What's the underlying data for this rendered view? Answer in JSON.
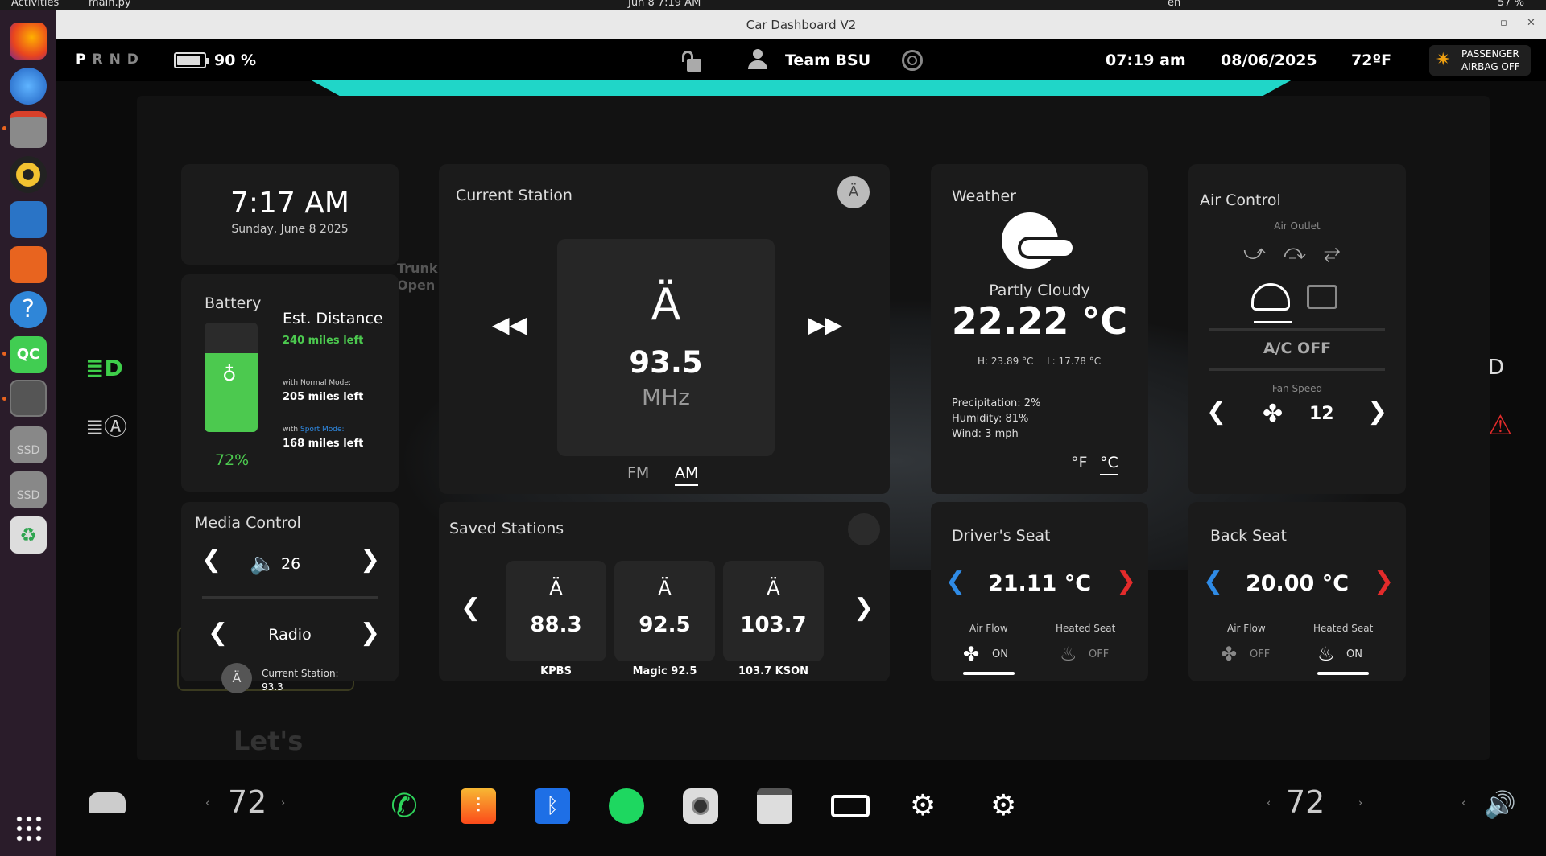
{
  "system": {
    "activities": "Activities",
    "app_menu": "main.py",
    "clock": "Jun 8 7:19 AM",
    "locale": "en",
    "battery_pct": "57 %"
  },
  "window": {
    "title": "Car Dashboard V2"
  },
  "status": {
    "gears": [
      "P",
      "R",
      "N",
      "D"
    ],
    "active_gear": "P",
    "battery": "90 %",
    "user": "Team BSU",
    "time": "07:19 am",
    "date": "08/06/2025",
    "temp": "72ºF",
    "airbag_line1": "PASSENGER",
    "airbag_line2": "AIRBAG OFF"
  },
  "clock_card": {
    "time": "7:17 AM",
    "date": "Sunday, June 8 2025"
  },
  "battery_card": {
    "title": "Battery",
    "percent": "72%",
    "level": 0.72,
    "est_title": "Est. Distance",
    "est_miles": "240 miles left",
    "normal_prefix": "with",
    "normal_label": "Normal Mode:",
    "normal_miles": "205 miles left",
    "sport_prefix": "with",
    "sport_label": "Sport Mode:",
    "sport_miles": "168 miles left"
  },
  "background_car": {
    "trunk": "Trunk",
    "open": "Open",
    "lets": "Let's"
  },
  "media": {
    "title": "Media Control",
    "volume": "26",
    "source": "Radio",
    "current_label": "Current Station:",
    "current_value": "93.3"
  },
  "station": {
    "title": "Current Station",
    "freq": "93.5",
    "unit": "MHz",
    "band_fm": "FM",
    "band_am": "AM",
    "active_band": "AM"
  },
  "saved": {
    "title": "Saved Stations",
    "stations": [
      {
        "freq": "88.3",
        "name": "KPBS"
      },
      {
        "freq": "92.5",
        "name": "Magic 92.5"
      },
      {
        "freq": "103.7",
        "name": "103.7 KSON"
      }
    ]
  },
  "weather": {
    "title": "Weather",
    "condition": "Partly Cloudy",
    "temp": "22.22 °C",
    "high": "H: 23.89 °C",
    "low": "L: 17.78 °C",
    "precip": "Precipitation: 2%",
    "humidity": "Humidity: 81%",
    "wind": "Wind: 3 mph",
    "unit_f": "°F",
    "unit_c": "°C",
    "active_unit": "°C"
  },
  "air": {
    "title": "Air Control",
    "outlet_label": "Air Outlet",
    "ac_status": "A/C OFF",
    "fan_label": "Fan Speed",
    "fan_speed": "12"
  },
  "driver_seat": {
    "title": "Driver's Seat",
    "temp": "21.11 °C",
    "airflow_label": "Air Flow",
    "airflow_state": "ON",
    "heated_label": "Heated Seat",
    "heated_state": "OFF"
  },
  "back_seat": {
    "title": "Back Seat",
    "temp": "20.00 °C",
    "airflow_label": "Air Flow",
    "airflow_state": "OFF",
    "heated_label": "Heated Seat",
    "heated_state": "ON"
  },
  "bottom": {
    "left_temp": "72",
    "right_temp": "72"
  },
  "colors": {
    "accent": "#20d6c8",
    "battery_green": "#4cc94f",
    "blue": "#2f8be6",
    "red": "#e32b2b"
  }
}
